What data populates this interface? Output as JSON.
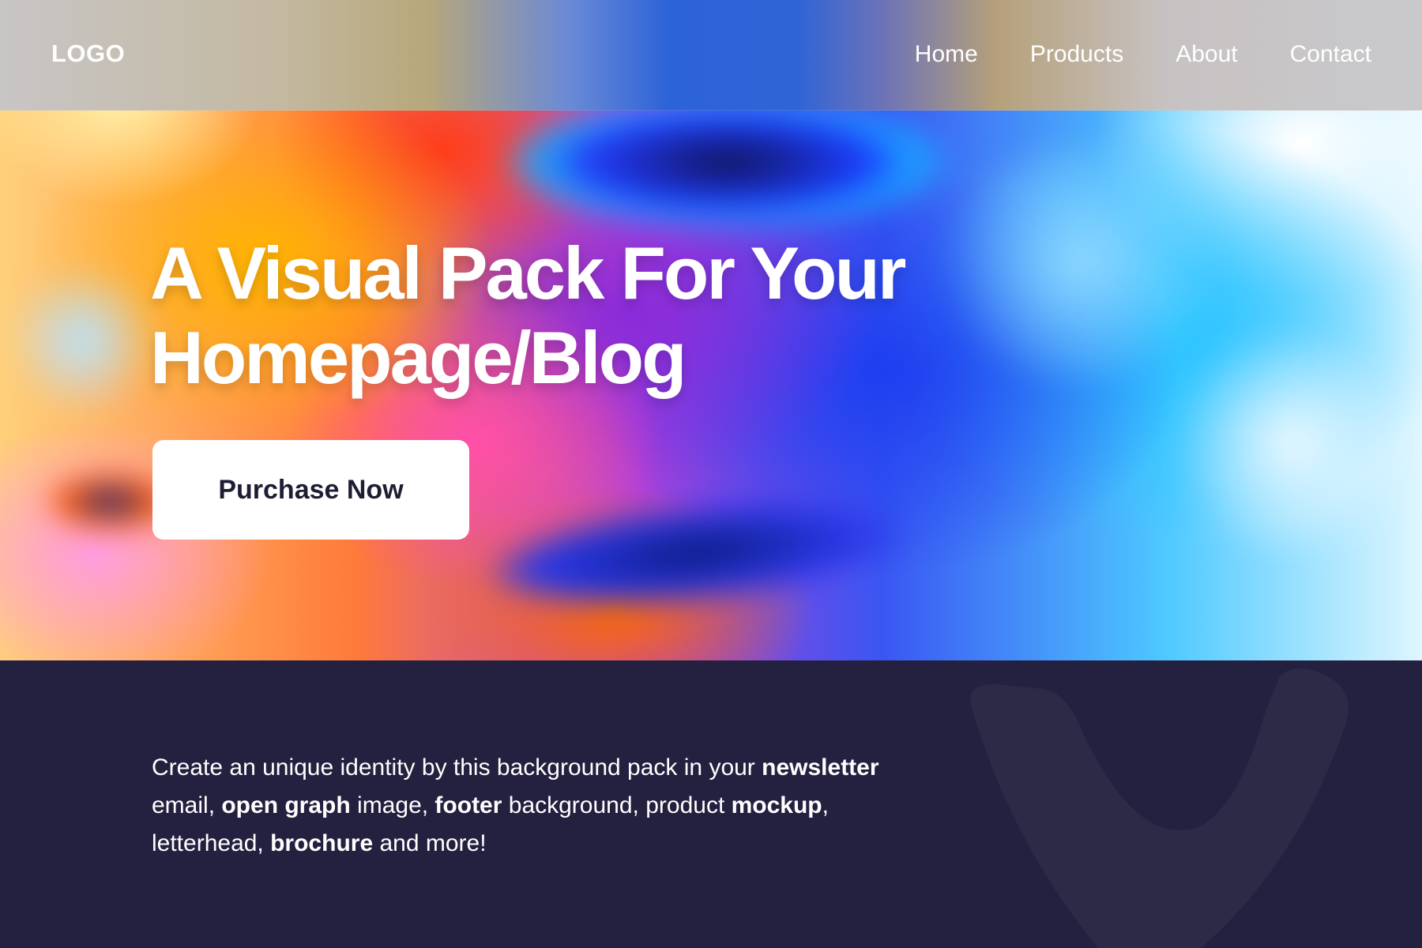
{
  "nav": {
    "logo": "LOGO",
    "items": [
      {
        "label": "Home"
      },
      {
        "label": "Products"
      },
      {
        "label": "About"
      },
      {
        "label": "Contact"
      }
    ]
  },
  "hero": {
    "headline_line1": "A Visual Pack For Your",
    "headline_line2": "Homepage/Blog",
    "cta_label": "Purchase Now"
  },
  "info": {
    "segments": [
      {
        "text": "Create an unique identity by this background pack in your ",
        "bold": false
      },
      {
        "text": "newsletter",
        "bold": true
      },
      {
        "text": " email, ",
        "bold": false
      },
      {
        "text": "open graph",
        "bold": true
      },
      {
        "text": " image, ",
        "bold": false
      },
      {
        "text": "footer",
        "bold": true
      },
      {
        "text": " background, product ",
        "bold": false
      },
      {
        "text": "mockup",
        "bold": true
      },
      {
        "text": ", letterhead, ",
        "bold": false
      },
      {
        "text": "brochure",
        "bold": true
      },
      {
        "text": " and more!",
        "bold": false
      }
    ]
  },
  "colors": {
    "dark_bg": "#24203f",
    "button_bg": "#ffffff",
    "button_text": "#1d1d33",
    "decor": "#2d2a48"
  }
}
